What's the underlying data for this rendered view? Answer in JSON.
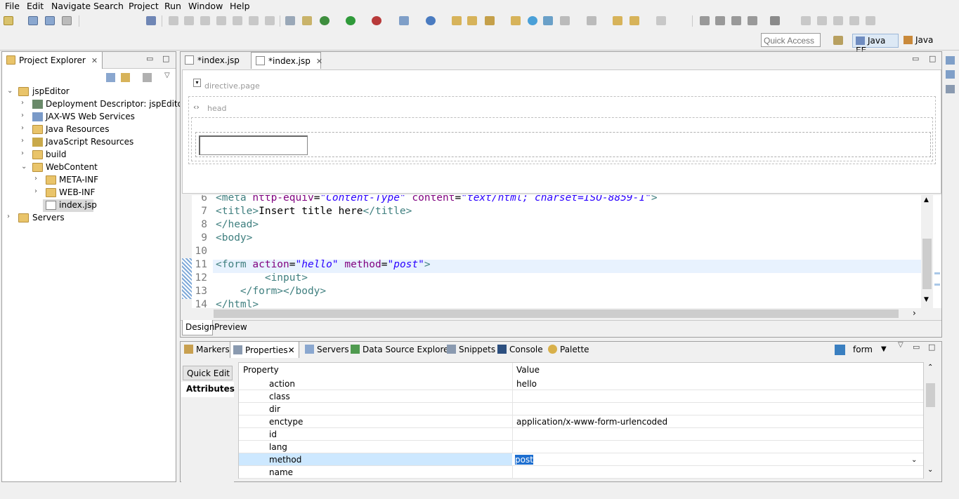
{
  "menu": [
    "File",
    "Edit",
    "Navigate",
    "Search",
    "Project",
    "Run",
    "Window",
    "Help"
  ],
  "quick_access": {
    "placeholder": "Quick Access"
  },
  "perspectives": {
    "javaee": "Java EE",
    "java": "Java"
  },
  "project_explorer": {
    "title": "Project Explorer",
    "tree": [
      {
        "label": "jspEditor",
        "level": 0,
        "expanded": true
      },
      {
        "label": "Deployment Descriptor: jspEditor",
        "level": 1
      },
      {
        "label": "JAX-WS Web Services",
        "level": 1
      },
      {
        "label": "Java Resources",
        "level": 1
      },
      {
        "label": "JavaScript Resources",
        "level": 1
      },
      {
        "label": "build",
        "level": 1
      },
      {
        "label": "WebContent",
        "level": 1,
        "expanded": true
      },
      {
        "label": "META-INF",
        "level": 2
      },
      {
        "label": "WEB-INF",
        "level": 2
      },
      {
        "label": "index.jsp",
        "level": 2,
        "selected": true
      },
      {
        "label": "Servers",
        "level": 0
      }
    ]
  },
  "editor": {
    "tabs": [
      {
        "label": "*index.jsp",
        "active": false
      },
      {
        "label": "*index.jsp",
        "active": true
      }
    ],
    "design": {
      "directive": "directive.page",
      "head": "head"
    },
    "lines": [
      {
        "n": "6",
        "segs": [
          [
            "tag",
            "<meta "
          ],
          [
            "attr",
            "http-equiv"
          ],
          [
            "plain",
            "="
          ],
          [
            "val",
            "\"Content-Type\""
          ],
          [
            "plain",
            " "
          ],
          [
            "attr",
            "content"
          ],
          [
            "plain",
            "="
          ],
          [
            "val",
            "\"text/html; charset=ISO-8859-1\""
          ],
          [
            "tag",
            ">"
          ]
        ]
      },
      {
        "n": "7",
        "segs": [
          [
            "tag",
            "<title>"
          ],
          [
            "plain",
            "Insert title here"
          ],
          [
            "tag",
            "</title>"
          ]
        ]
      },
      {
        "n": "8",
        "segs": [
          [
            "tag",
            "</head>"
          ]
        ]
      },
      {
        "n": "9",
        "segs": [
          [
            "tag",
            "<body>"
          ]
        ]
      },
      {
        "n": "10",
        "segs": []
      },
      {
        "n": "11",
        "segs": [
          [
            "tag",
            "<form "
          ],
          [
            "attr",
            "action"
          ],
          [
            "plain",
            "="
          ],
          [
            "val",
            "\"hello\""
          ],
          [
            "plain",
            " "
          ],
          [
            "attr",
            "method"
          ],
          [
            "plain",
            "="
          ],
          [
            "val",
            "\"post\""
          ],
          [
            "tag",
            ">"
          ]
        ]
      },
      {
        "n": "12",
        "segs": [
          [
            "plain",
            "        "
          ],
          [
            "tag",
            "<input>"
          ]
        ]
      },
      {
        "n": "13",
        "segs": [
          [
            "plain",
            "    "
          ],
          [
            "tag",
            "</form></body>"
          ]
        ]
      },
      {
        "n": "14",
        "segs": [
          [
            "tag",
            "</html>"
          ]
        ]
      }
    ],
    "bottom_tabs": [
      "Design",
      "Preview"
    ]
  },
  "views": {
    "tabs": [
      "Markers",
      "Properties",
      "Servers",
      "Data Source Explorer",
      "Snippets",
      "Console",
      "Palette"
    ],
    "selection": "form",
    "quick_edit": "Quick Edit",
    "attributes": "Attributes",
    "headers": {
      "property": "Property",
      "value": "Value"
    },
    "properties": [
      {
        "name": "action",
        "value": "hello"
      },
      {
        "name": "class",
        "value": ""
      },
      {
        "name": "dir",
        "value": ""
      },
      {
        "name": "enctype",
        "value": "application/x-www-form-urlencoded"
      },
      {
        "name": "id",
        "value": ""
      },
      {
        "name": "lang",
        "value": ""
      },
      {
        "name": "method",
        "value": "post",
        "selected": true
      },
      {
        "name": "name",
        "value": ""
      }
    ]
  },
  "colors": {
    "accent": "#cde8ff",
    "current_line": "#e8f2fe",
    "tag": "#3f7f7f",
    "attr": "#7f007f",
    "val": "#2a00ff"
  }
}
